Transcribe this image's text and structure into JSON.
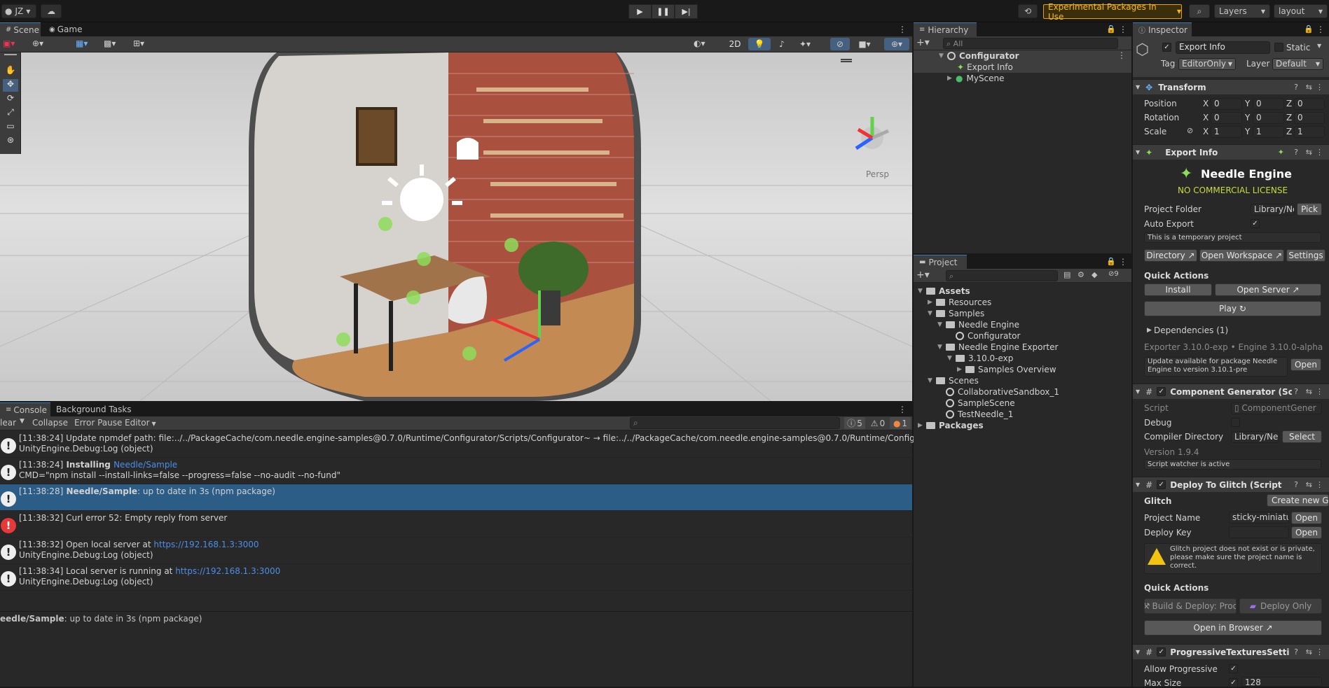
{
  "topbar": {
    "account": "JZ",
    "experimental": "Experimental Packages In Use",
    "layers": "Layers",
    "layout": "layout"
  },
  "scene": {
    "tab_scene": "Scene",
    "tab_game": "Game",
    "btn_2d": "2D",
    "persp": "Persp"
  },
  "console": {
    "tab_console": "Console",
    "tab_bg": "Background Tasks",
    "clear": "lear",
    "collapse": "Collapse",
    "error_pause": "Error Pause",
    "editor": "Editor",
    "count_log": "5",
    "count_warn": "0",
    "count_err": "1",
    "logs": [
      {
        "time": "[11:38:24]",
        "text": " Update npmdef path: file:../../PackageCache/com.needle.engine-samples@0.7.0/Runtime/Configurator/Scripts/Configurator~ → file:../../PackageCache/com.needle.engine-samples@0.7.0/Runtime/Configurator/Scripts",
        "l2": "UnityEngine.Debug:Log (object)"
      },
      {
        "time": "[11:38:24]",
        "bold": " Installing ",
        "link": "Needle/Sample",
        "l2": "CMD=\"npm install --install-links=false --progress=false --no-audit --no-fund\""
      },
      {
        "time": "[11:38:28]",
        "bold": " Needle/Sample",
        "text": ": up to date in 3s (npm package)",
        "l2": ""
      },
      {
        "time": "[11:38:32]",
        "text": " Curl error 52: Empty reply from server",
        "l2": ""
      },
      {
        "time": "[11:38:32]",
        "text": " Open local server at ",
        "link": "https://192.168.1.3:3000",
        "l2": "UnityEngine.Debug:Log (object)"
      },
      {
        "time": "[11:38:34]",
        "text": " Local server is running at ",
        "link": "https://192.168.1.3:3000",
        "l2": "UnityEngine.Debug:Log (object)"
      }
    ],
    "detail_bold": "eedle/Sample",
    "detail_rest": ": up to date in 3s (npm package)"
  },
  "hierarchy": {
    "title": "Hierarchy",
    "search_placeholder": "All",
    "items": [
      "Configurator",
      "Export Info",
      "MyScene"
    ]
  },
  "project": {
    "title": "Project",
    "count": "9",
    "items": [
      "Assets",
      "Resources",
      "Samples",
      "Needle Engine",
      "Configurator",
      "Needle Engine Exporter",
      "3.10.0-exp",
      "Samples Overview",
      "Scenes",
      "CollaborativeSandbox_1",
      "SampleScene",
      "TestNeedle_1",
      "Packages"
    ]
  },
  "inspector": {
    "title": "Inspector",
    "object_name": "Export Info",
    "static": "Static",
    "tag_label": "Tag",
    "tag": "EditorOnly",
    "layer_label": "Layer",
    "layer": "Default",
    "transform": {
      "title": "Transform",
      "position": "Position",
      "rotation": "Rotation",
      "scale": "Scale",
      "x": "X",
      "y": "Y",
      "z": "Z",
      "pos": [
        "0",
        "0",
        "0"
      ],
      "rot": [
        "0",
        "0",
        "0"
      ],
      "scl": [
        "1",
        "1",
        "1"
      ]
    },
    "export": {
      "title": "Export Info",
      "brand": "Needle Engine",
      "license": "NO COMMERCIAL LICENSE",
      "project_folder": "Project Folder",
      "folder_value": "Library/Ne",
      "pick": "Pick",
      "auto_export": "Auto Export",
      "temp_note": "This is a temporary project",
      "directory": "Directory ↗",
      "open_workspace": "Open Workspace ↗",
      "settings": "Settings",
      "quick_actions": "Quick Actions",
      "install": "Install",
      "open_server": "Open Server ↗",
      "play": "Play ↻",
      "dependencies": "Dependencies (1)",
      "version": "Exporter 3.10.0-exp • Engine 3.10.0-alpha",
      "update_note": "Update available for package Needle Engine to version 3.10.1-pre",
      "open": "Open"
    },
    "compgen": {
      "title": "Component Generator (Sc",
      "script": "Script",
      "script_val": "ComponentGener",
      "debug": "Debug",
      "compiler_dir": "Compiler Directory",
      "compiler_val": "Library/Nee",
      "select": "Select",
      "version": "Version 1.9.4",
      "watcher": "Script watcher is active"
    },
    "glitch": {
      "title": "Deploy To Glitch (Script",
      "glitch": "Glitch",
      "create_new": "Create new G",
      "project_name": "Project Name",
      "project_val": "sticky-miniatu",
      "open": "Open",
      "deploy_key": "Deploy Key",
      "warning": "Glitch project does not exist or is private, please make sure the project name is correct.",
      "quick_actions": "Quick Actions",
      "build_deploy": "Build & Deploy: Prod",
      "deploy_only": "Deploy Only",
      "open_browser": "Open in Browser ↗"
    },
    "progressive": {
      "title": "ProgressiveTexturesSetti",
      "allow": "Allow Progressive",
      "max_size": "Max Size",
      "max_val": "128"
    }
  }
}
